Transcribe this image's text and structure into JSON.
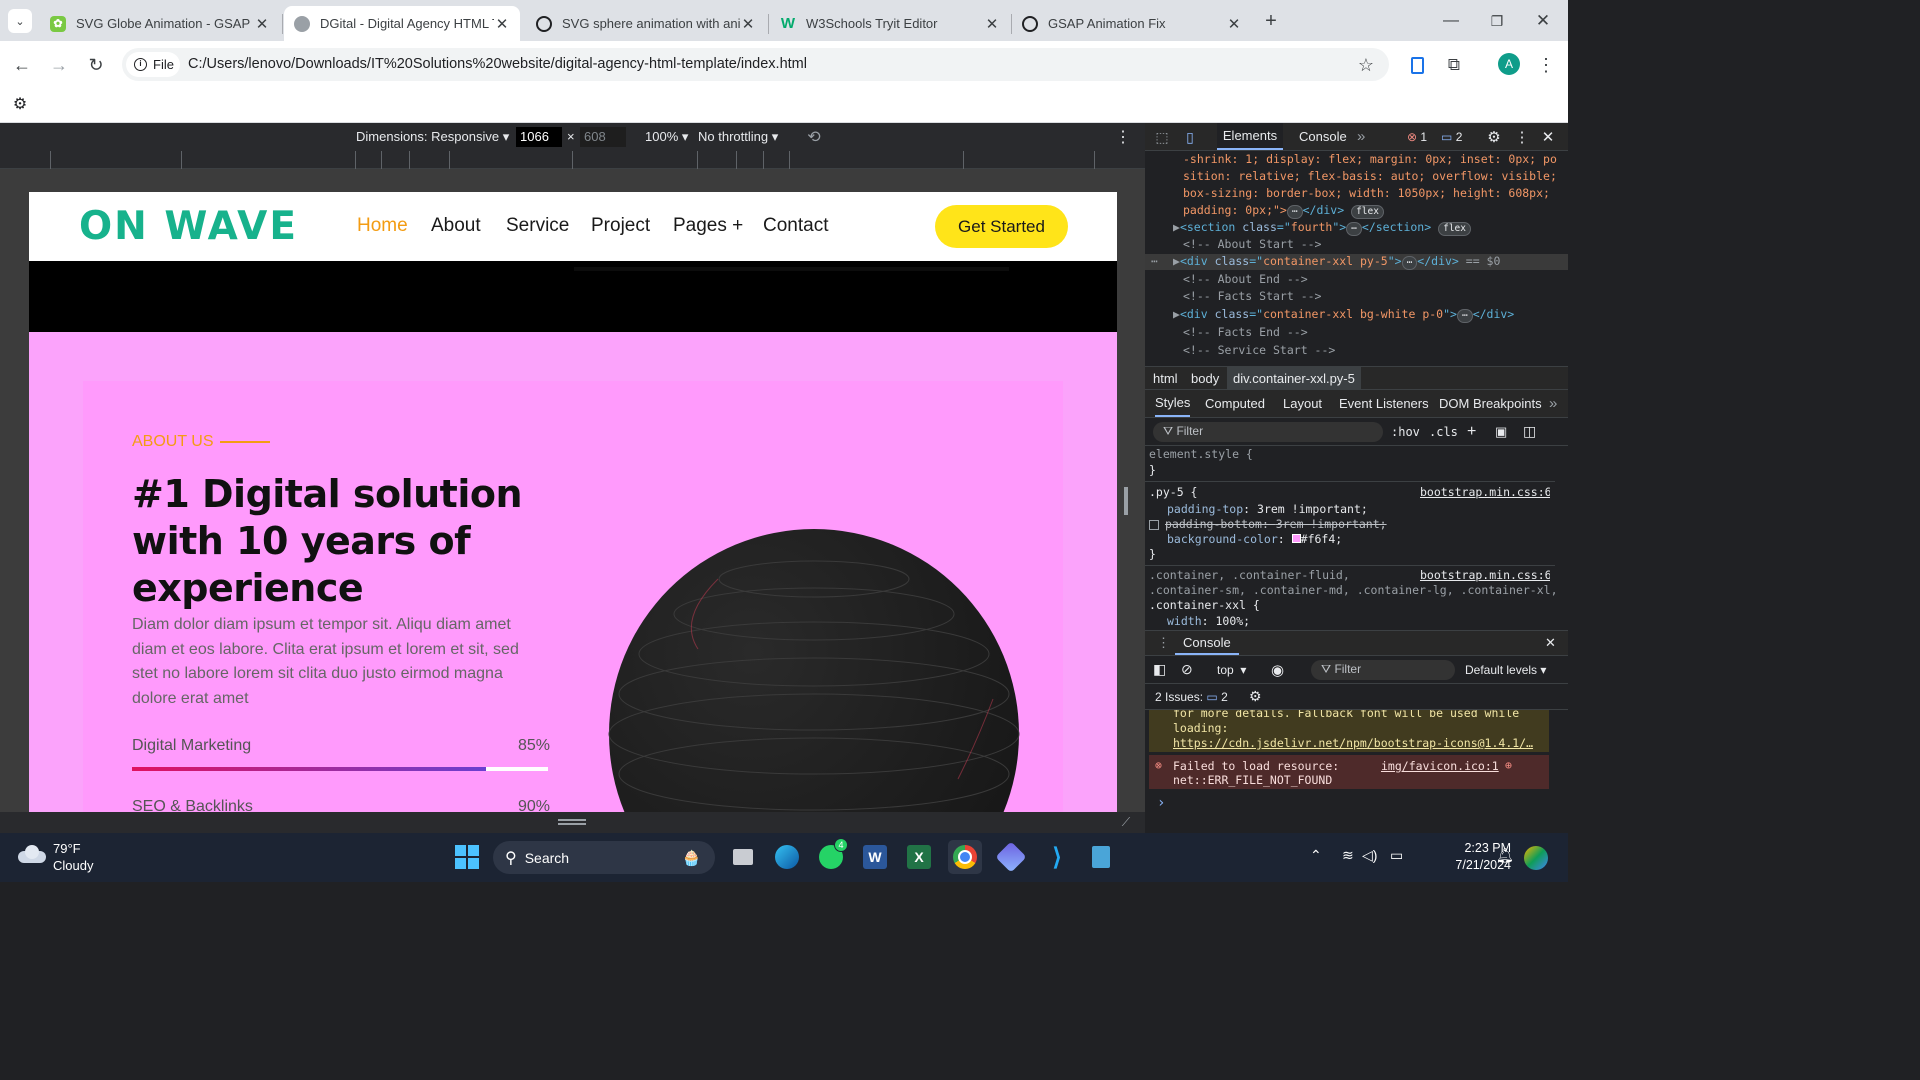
{
  "browser": {
    "tabs": [
      {
        "title": "SVG Globe Animation - GSAP -",
        "icon": "globe-app-icon",
        "active": false
      },
      {
        "title": "DGital - Digital Agency HTML Te",
        "icon": "page-icon",
        "active": true
      },
      {
        "title": "SVG sphere animation with ani",
        "icon": "chatgpt-icon",
        "active": false
      },
      {
        "title": "W3Schools Tryit Editor",
        "icon": "w3schools-icon",
        "active": false
      },
      {
        "title": "GSAP Animation Fix",
        "icon": "chatgpt-icon",
        "active": false
      }
    ],
    "address": {
      "scheme_label": "File",
      "url": "C:/Users/lenovo/Downloads/IT%20Solutions%20website/digital-agency-html-template/index.html"
    },
    "profile_initial": "A"
  },
  "device_toolbar": {
    "dimensions_label": "Dimensions: Responsive",
    "width": "1066",
    "height": "608",
    "times": "×",
    "zoom": "100%",
    "throttling": "No throttling"
  },
  "site": {
    "logo": "ON WAVE",
    "nav": [
      "Home",
      "About",
      "Service",
      "Project",
      "Pages +",
      "Contact"
    ],
    "nav_active_color": "#f39c12",
    "cta": "Get Started",
    "about_label": "ABOUT US",
    "headline": "#1 Digital solution with 10 years of experience",
    "paragraph": "Diam dolor diam ipsum et tempor sit. Aliqu diam amet diam et eos labore. Clita erat ipsum et lorem et sit, sed stet no labore lorem sit clita duo justo eirmod magna dolore erat amet",
    "skills": [
      {
        "label": "Digital Marketing",
        "value": "85%",
        "fraction": 0.85
      },
      {
        "label": "SEO & Backlinks",
        "value": "90%",
        "fraction": 0.9
      }
    ],
    "colors": {
      "brand": "#17b28c",
      "accent": "#ffe419",
      "pink": "#ff9afc"
    }
  },
  "devtools": {
    "tabs": [
      "Elements",
      "Console"
    ],
    "error_count": "1",
    "issue_count": "2",
    "dom_lines": [
      "-shrink: 1; display: flex; margin: 0px; inset: 0px; po",
      "sition: relative; flex-basis: auto; overflow: visible;",
      "box-sizing: border-box; width: 1050px; height: 608px;",
      "padding: 0px;\">",
      "<!-- About Start -->",
      "<!-- About End -->",
      "<!-- Facts Start -->",
      "<!-- Facts End -->",
      "<!-- Service Start -->"
    ],
    "section_line": {
      "tag": "section",
      "attr": "class",
      "value": "fourth",
      "badge": "flex"
    },
    "selected_line": {
      "tag": "div",
      "attr": "class",
      "value": "container-xxl py-5",
      "suffix": "== $0"
    },
    "facts_line": {
      "tag": "div",
      "attr": "class",
      "value": "container-xxl bg-white p-0"
    },
    "flex_badge": "flex",
    "breadcrumb": [
      "html",
      "body",
      "div.container-xxl.py-5"
    ],
    "styles_tabs": [
      "Styles",
      "Computed",
      "Layout",
      "Event Listeners",
      "DOM Breakpoints"
    ],
    "filter_placeholder": "Filter",
    "hov": ":hov",
    "cls": ".cls",
    "rules": {
      "element_style": "element.style {",
      "close": "}",
      "py5_selector": ".py-5 {",
      "py5_source": "bootstrap.min.css:6",
      "padding_top": [
        "padding-top",
        "3rem !important;"
      ],
      "padding_bottom": [
        "padding-bottom",
        "3rem !important;"
      ],
      "bg": [
        "background-color",
        "#f6f4;"
      ],
      "container_selector_1": ".container, .container-fluid,",
      "container_selector_2": ".container-sm, .container-md, .container-lg, .container-xl,",
      "container_selector_3": ".container-xxl {",
      "container_source": "bootstrap.min.css:6",
      "width": [
        "width",
        "100%;"
      ]
    },
    "console": {
      "title": "Console",
      "context": "top",
      "filter": "Filter",
      "levels": "Default levels",
      "issues_label": "2 Issues:",
      "issues_count": "2",
      "warn_line1": "for more details. Fallback font will be used while",
      "warn_line2": "loading:",
      "warn_link": "https://cdn.jsdelivr.net/npm/bootstrap-icons@1.4.1/…",
      "error_line1": "Failed to load resource:",
      "error_line2": "net::ERR_FILE_NOT_FOUND",
      "error_source": "img/favicon.ico:1",
      "prompt": "›"
    }
  },
  "taskbar": {
    "weather_temp": "79°F",
    "weather_desc": "Cloudy",
    "search_label": "Search",
    "time": "2:23 PM",
    "date": "7/21/2024",
    "whatsapp_badge": "4"
  }
}
